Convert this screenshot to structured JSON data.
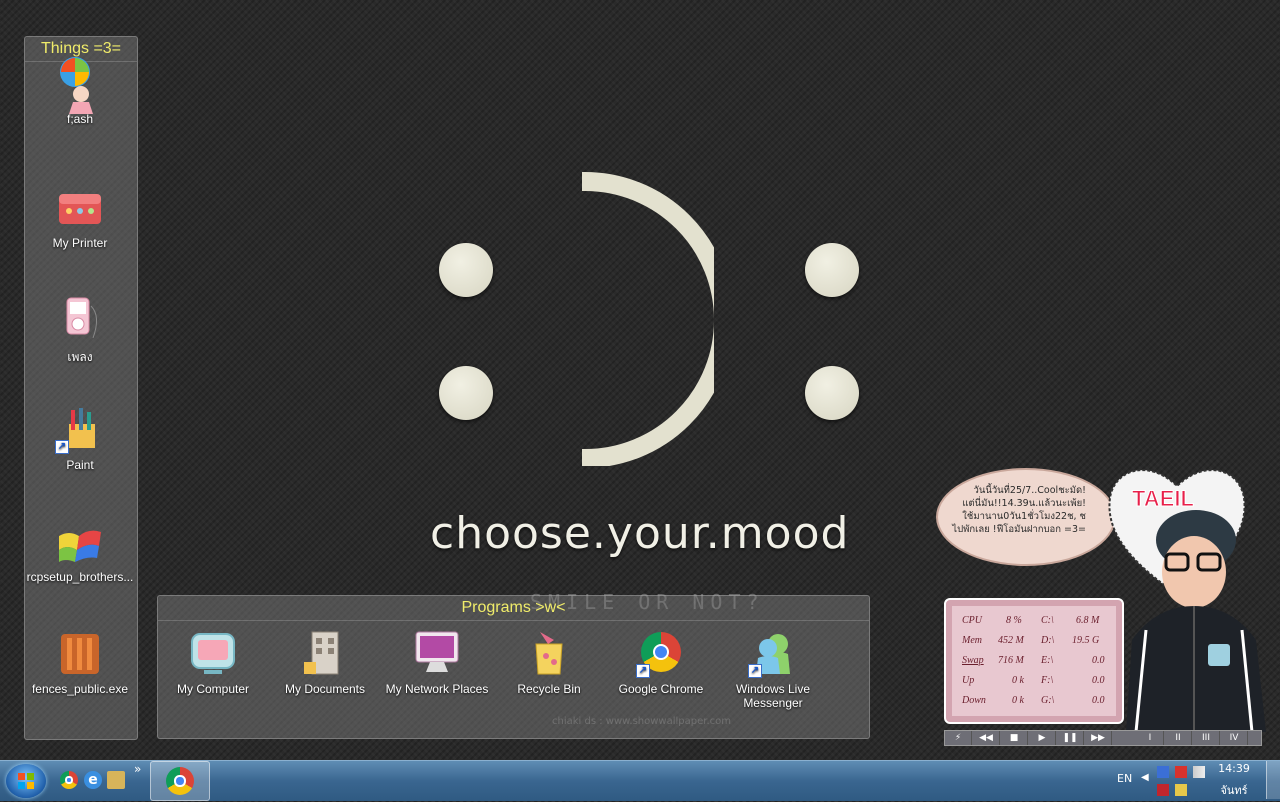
{
  "wallpaper": {
    "title": "choose.your.mood",
    "subtitle": "SMILE OR NOT?",
    "credit": "chiaki ds : www.showwallpaper.com"
  },
  "fence_things": {
    "title": "Things =3=",
    "icons": [
      {
        "label": "f;ash",
        "icon": "flash-doll-icon"
      },
      {
        "label": "My Printer",
        "icon": "printer-box-icon"
      },
      {
        "label": "เพลง",
        "icon": "music-player-icon"
      },
      {
        "label": "Paint",
        "icon": "paint-icon"
      },
      {
        "label": "rcpsetup_brothers...",
        "icon": "windows-flag-icon"
      },
      {
        "label": "fences_public.exe",
        "icon": "fences-icon"
      }
    ]
  },
  "fence_programs": {
    "title": "Programs >w<",
    "icons": [
      {
        "label": "My Computer",
        "icon": "computer-icon"
      },
      {
        "label": "My Documents",
        "icon": "documents-icon"
      },
      {
        "label": "My Network Places",
        "icon": "network-icon"
      },
      {
        "label": "Recycle Bin",
        "icon": "recycle-bin-icon"
      },
      {
        "label": "Google Chrome",
        "icon": "chrome-icon"
      },
      {
        "label": "Windows Live Messenger",
        "icon": "messenger-icon"
      }
    ]
  },
  "bubble": {
    "line1": "วันนี้วันที่25/7..Coolชะมัด!",
    "line2": "แต่นี่มัน!!14.39น.แล้วนะเพ้ย!",
    "line3": "ใช้มานาน0วัน1ชั่วโมง22ช, ช",
    "line4": "ไปพักเลย !ฟีโอมันฝากบอก =3="
  },
  "avatar": {
    "name": "TAEIL"
  },
  "meter": {
    "rows": [
      {
        "label": "CPU",
        "value": "8  %",
        "drive": "C:\\",
        "drive_value": "6.8 M"
      },
      {
        "label": "Mem",
        "value": "452 M",
        "drive": "D:\\",
        "drive_value": "19.5 G"
      },
      {
        "label": "Swap",
        "value": "716 M",
        "drive": "E:\\",
        "drive_value": "0.0"
      },
      {
        "label": "Up",
        "value": "0 k",
        "drive": "F:\\",
        "drive_value": "0.0"
      },
      {
        "label": "Down",
        "value": "0 k",
        "drive": "G:\\",
        "drive_value": "0.0"
      }
    ]
  },
  "media": {
    "buttons": [
      "⚡",
      "◀◀",
      "■",
      "▶",
      "❚❚",
      "▶▶"
    ],
    "tabs": [
      "I",
      "II",
      "III",
      "IV"
    ]
  },
  "taskbar": {
    "quicklaunch_more": "»",
    "language": "EN",
    "time": "14:39",
    "day": "จันทร์"
  }
}
